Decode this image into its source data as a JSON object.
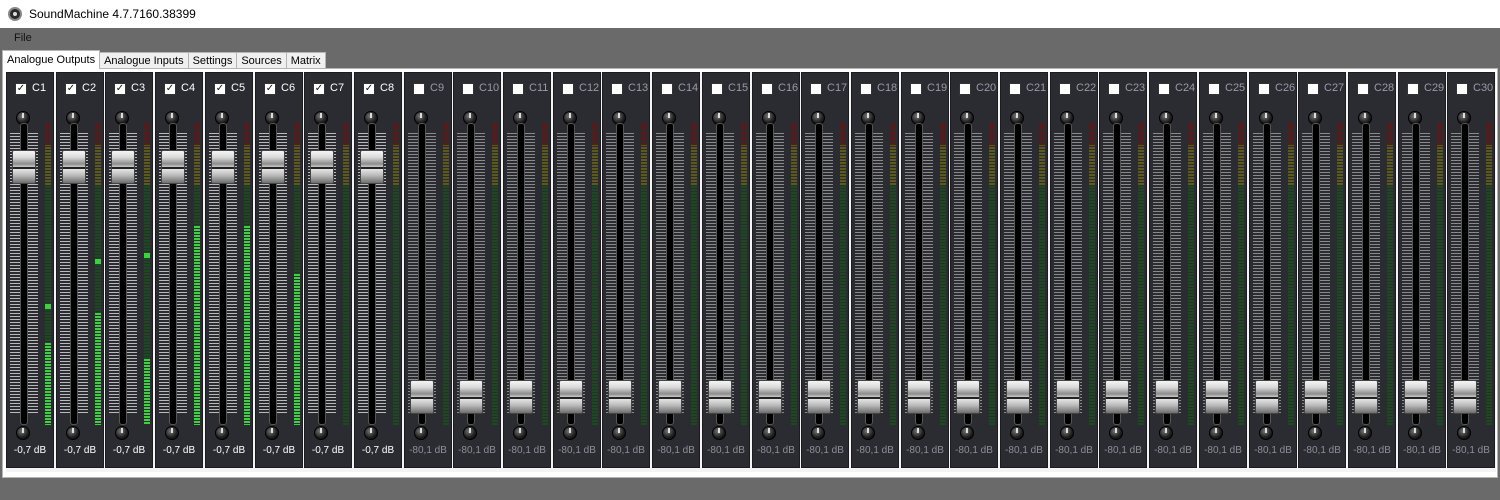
{
  "window": {
    "title": "SoundMachine 4.7.7160.38399"
  },
  "menu": {
    "file": "File"
  },
  "tabs": [
    {
      "label": "Analogue Outputs",
      "active": true
    },
    {
      "label": "Analogue Inputs",
      "active": false
    },
    {
      "label": "Settings",
      "active": false
    },
    {
      "label": "Sources",
      "active": false
    },
    {
      "label": "Matrix",
      "active": false
    }
  ],
  "colors": {
    "strip_bg": "#2b2b32",
    "meter_green": "#39d33d",
    "meter_yellow": "#5c5a1a",
    "meter_red": "#5a1a1a"
  },
  "channels": [
    {
      "label": "C1",
      "checked": true,
      "db": "-0,7 dB",
      "fader": 0.9,
      "meter": 0.27,
      "peak": 0.4
    },
    {
      "label": "C2",
      "checked": true,
      "db": "-0,7 dB",
      "fader": 0.9,
      "meter": 0.37,
      "peak": 0.55
    },
    {
      "label": "C3",
      "checked": true,
      "db": "-0,7 dB",
      "fader": 0.9,
      "meter": 0.22,
      "peak": 0.57
    },
    {
      "label": "C4",
      "checked": true,
      "db": "-0,7 dB",
      "fader": 0.9,
      "meter": 0.66,
      "peak": 0
    },
    {
      "label": "C5",
      "checked": true,
      "db": "-0,7 dB",
      "fader": 0.9,
      "meter": 0.66,
      "peak": 0
    },
    {
      "label": "C6",
      "checked": true,
      "db": "-0,7 dB",
      "fader": 0.9,
      "meter": 0.5,
      "peak": 0
    },
    {
      "label": "C7",
      "checked": true,
      "db": "-0,7 dB",
      "fader": 0.9,
      "meter": 0,
      "peak": 0
    },
    {
      "label": "C8",
      "checked": true,
      "db": "-0,7 dB",
      "fader": 0.9,
      "meter": 0,
      "peak": 0
    },
    {
      "label": "C9",
      "checked": false,
      "db": "-80,1 dB",
      "fader": 0.04,
      "meter": 0,
      "peak": 0
    },
    {
      "label": "C10",
      "checked": false,
      "db": "-80,1 dB",
      "fader": 0.04,
      "meter": 0,
      "peak": 0
    },
    {
      "label": "C11",
      "checked": false,
      "db": "-80,1 dB",
      "fader": 0.04,
      "meter": 0,
      "peak": 0
    },
    {
      "label": "C12",
      "checked": false,
      "db": "-80,1 dB",
      "fader": 0.04,
      "meter": 0,
      "peak": 0
    },
    {
      "label": "C13",
      "checked": false,
      "db": "-80,1 dB",
      "fader": 0.04,
      "meter": 0,
      "peak": 0
    },
    {
      "label": "C14",
      "checked": false,
      "db": "-80,1 dB",
      "fader": 0.04,
      "meter": 0,
      "peak": 0
    },
    {
      "label": "C15",
      "checked": false,
      "db": "-80,1 dB",
      "fader": 0.04,
      "meter": 0,
      "peak": 0
    },
    {
      "label": "C16",
      "checked": false,
      "db": "-80,1 dB",
      "fader": 0.04,
      "meter": 0,
      "peak": 0
    },
    {
      "label": "C17",
      "checked": false,
      "db": "-80,1 dB",
      "fader": 0.04,
      "meter": 0,
      "peak": 0
    },
    {
      "label": "C18",
      "checked": false,
      "db": "-80,1 dB",
      "fader": 0.04,
      "meter": 0,
      "peak": 0
    },
    {
      "label": "C19",
      "checked": false,
      "db": "-80,1 dB",
      "fader": 0.04,
      "meter": 0,
      "peak": 0
    },
    {
      "label": "C20",
      "checked": false,
      "db": "-80,1 dB",
      "fader": 0.04,
      "meter": 0,
      "peak": 0
    },
    {
      "label": "C21",
      "checked": false,
      "db": "-80,1 dB",
      "fader": 0.04,
      "meter": 0,
      "peak": 0
    },
    {
      "label": "C22",
      "checked": false,
      "db": "-80,1 dB",
      "fader": 0.04,
      "meter": 0,
      "peak": 0
    },
    {
      "label": "C23",
      "checked": false,
      "db": "-80,1 dB",
      "fader": 0.04,
      "meter": 0,
      "peak": 0
    },
    {
      "label": "C24",
      "checked": false,
      "db": "-80,1 dB",
      "fader": 0.04,
      "meter": 0,
      "peak": 0
    },
    {
      "label": "C25",
      "checked": false,
      "db": "-80,1 dB",
      "fader": 0.04,
      "meter": 0,
      "peak": 0
    },
    {
      "label": "C26",
      "checked": false,
      "db": "-80,1 dB",
      "fader": 0.04,
      "meter": 0,
      "peak": 0
    },
    {
      "label": "C27",
      "checked": false,
      "db": "-80,1 dB",
      "fader": 0.04,
      "meter": 0,
      "peak": 0
    },
    {
      "label": "C28",
      "checked": false,
      "db": "-80,1 dB",
      "fader": 0.04,
      "meter": 0,
      "peak": 0
    },
    {
      "label": "C29",
      "checked": false,
      "db": "-80,1 dB",
      "fader": 0.04,
      "meter": 0,
      "peak": 0
    },
    {
      "label": "C30",
      "checked": false,
      "db": "-80,1 dB",
      "fader": 0.04,
      "meter": 0,
      "peak": 0
    }
  ]
}
